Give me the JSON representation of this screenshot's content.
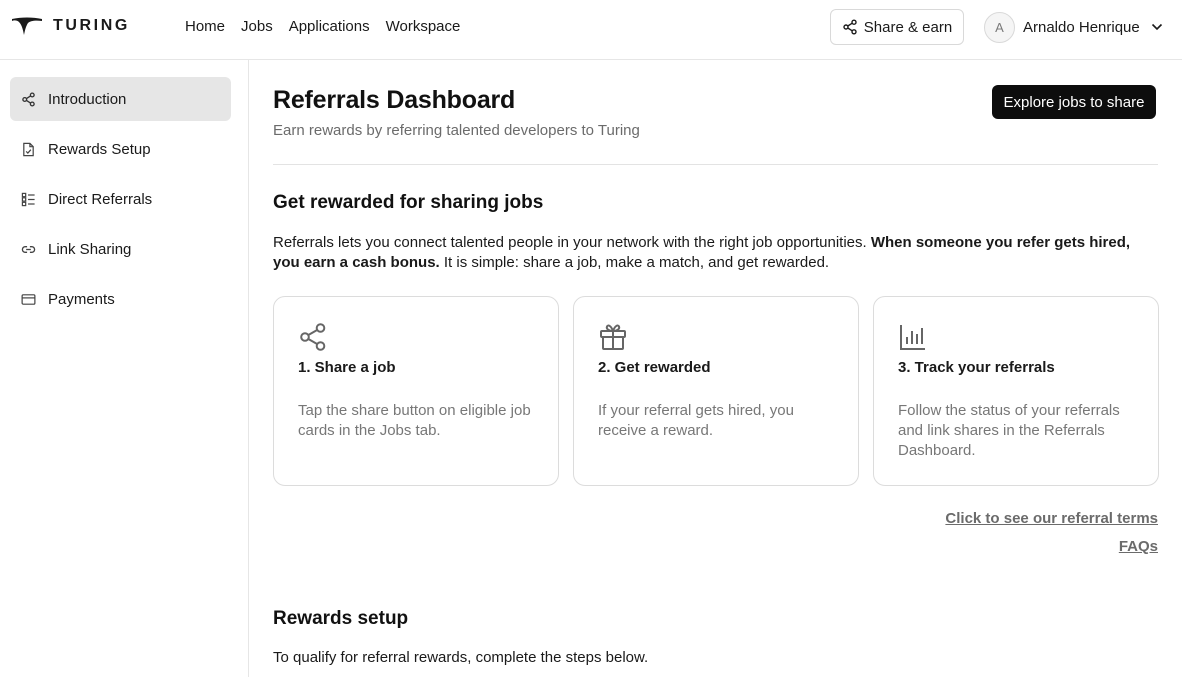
{
  "header": {
    "brand": "TURING",
    "nav": [
      {
        "label": "Home"
      },
      {
        "label": "Jobs"
      },
      {
        "label": "Applications"
      },
      {
        "label": "Workspace"
      }
    ],
    "share_earn_label": "Share & earn",
    "share_earn_icon": "share-icon",
    "user": {
      "initial": "A",
      "name": "Arnaldo Henrique"
    }
  },
  "sidebar": {
    "items": [
      {
        "label": "Introduction",
        "icon": "share-icon",
        "active": true
      },
      {
        "label": "Rewards Setup",
        "icon": "document-check-icon",
        "active": false
      },
      {
        "label": "Direct Referrals",
        "icon": "list-icon",
        "active": false
      },
      {
        "label": "Link Sharing",
        "icon": "link-icon",
        "active": false
      },
      {
        "label": "Payments",
        "icon": "credit-card-icon",
        "active": false
      }
    ]
  },
  "main": {
    "title": "Referrals Dashboard",
    "subtitle": "Earn rewards by referring talented developers to Turing",
    "explore_button": "Explore jobs to share",
    "section1_title": "Get rewarded for sharing jobs",
    "intro": {
      "part1": "Referrals lets you connect talented people in your network with the right job opportunities. ",
      "bold": "When someone you refer gets hired, you earn a cash bonus.",
      "part2": " It is simple: share a job, make a match, and get rewarded."
    },
    "cards": [
      {
        "icon": "share-icon",
        "title": "1. Share a job",
        "desc": "Tap the share button on eligible job cards in the Jobs tab."
      },
      {
        "icon": "gift-icon",
        "title": "2. Get rewarded",
        "desc": "If your referral gets hired, you receive a reward."
      },
      {
        "icon": "bar-chart-icon",
        "title": "3. Track your referrals",
        "desc": "Follow the status of your referrals and link shares in the Referrals Dashboard."
      }
    ],
    "terms_link": "Click to see our referral terms",
    "faqs_link": "FAQs",
    "section2_title": "Rewards setup",
    "qualify_text": "To qualify for referral rewards, complete the steps below."
  },
  "colors": {
    "primary_button": "#0d0d0d",
    "active_sidebar_bg": "#e6e6e6",
    "muted_text": "#6b6b6b"
  }
}
